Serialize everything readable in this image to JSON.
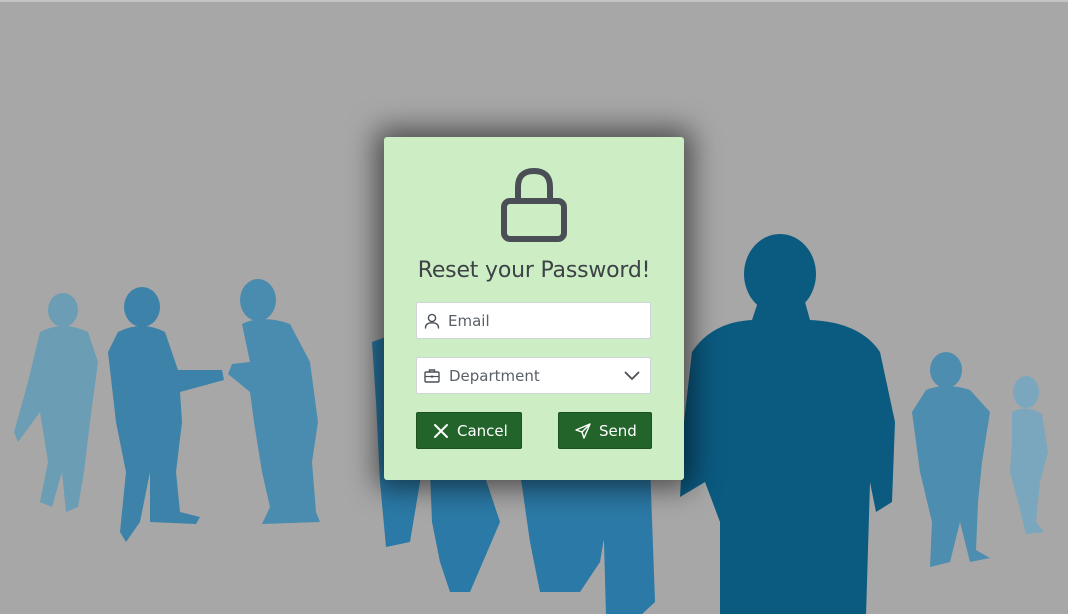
{
  "dialog": {
    "title": "Reset your Password!",
    "lock_icon": "lock-icon",
    "email": {
      "placeholder": "Email",
      "value": "",
      "icon": "user-icon"
    },
    "department": {
      "selected": "Department",
      "icon": "briefcase-icon",
      "chevron_icon": "chevron-down-icon"
    },
    "cancel": {
      "label": "Cancel",
      "icon": "close-icon"
    },
    "send": {
      "label": "Send",
      "icon": "send-icon"
    }
  },
  "colors": {
    "background": "#a7a7a7",
    "dialog_bg": "#cdeec4",
    "button_bg": "#23642a",
    "icon_dark": "#4a4f55",
    "silhouette_light": "#6a9bb3",
    "silhouette_mid": "#3f85aa",
    "silhouette_dark": "#0b5a80"
  }
}
